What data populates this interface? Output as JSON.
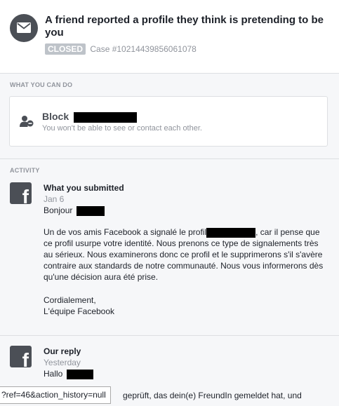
{
  "header": {
    "title": "A friend reported a profile they think is pretending to be you",
    "status_badge": "CLOSED",
    "case_number": "Case #10214439856061078"
  },
  "actions": {
    "section_label": "What you can do",
    "block_label": "Block",
    "block_description": "You won't be able to see or contact each other."
  },
  "activity": {
    "section_label": "Activity",
    "entries": [
      {
        "title": "What you submitted",
        "date": "Jan 6",
        "greeting": "Bonjour",
        "body_part1": "Un de vos amis Facebook a signalé le profil",
        "body_part2": ", car il pense que ce profil usurpe votre identité. Nous prenons ce type de signalements très au sérieux. Nous examinerons donc ce profil et le supprimerons s'il s'avère contraire aux standards de notre communauté. Nous vous informerons dès qu'une décision aura été prise.",
        "closing": "Cordialement,",
        "signature": "L'équipe Facebook"
      },
      {
        "title": "Our reply",
        "date": "Yesterday",
        "greeting": "Hallo",
        "body_fragment": "geprüft, das dein(e) FreundIn gemeldet hat, und"
      }
    ]
  },
  "browser": {
    "status_url": "?ref=46&action_history=null"
  }
}
